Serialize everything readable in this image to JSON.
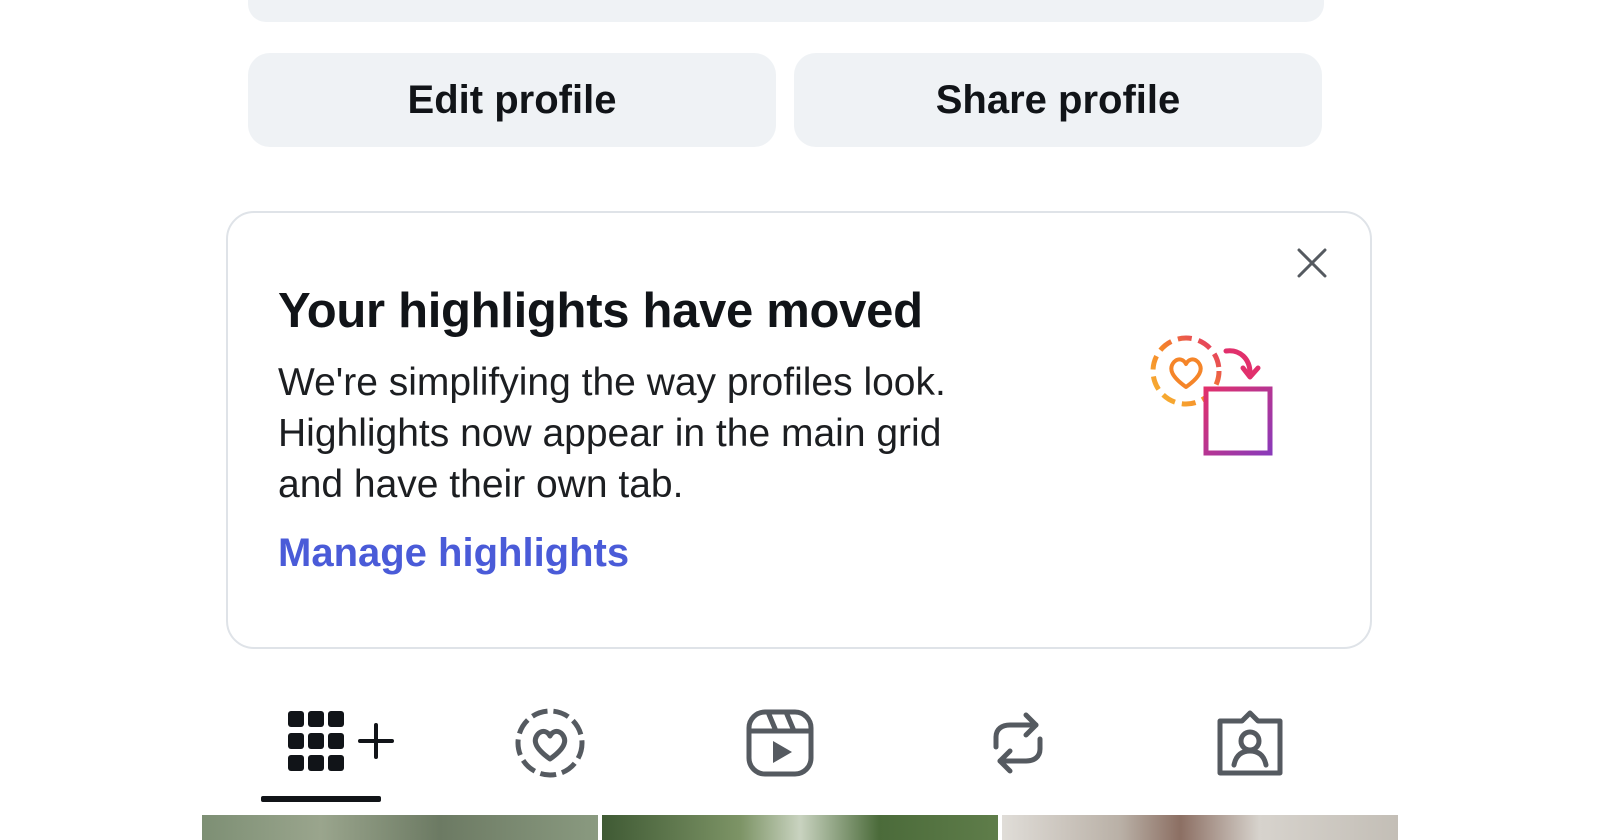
{
  "profile_actions": {
    "edit_label": "Edit profile",
    "share_label": "Share profile"
  },
  "notice_card": {
    "title": "Your highlights have moved",
    "body_lines": [
      "We're simplifying the way profiles look.",
      "Highlights now appear in the main grid",
      "and have their own tab."
    ],
    "link_label": "Manage highlights",
    "close_icon": "close-icon",
    "illustration_icon": "highlights-to-grid-icon",
    "link_color": "#4a5bd8"
  },
  "tabs": [
    {
      "name": "posts-grid",
      "icon": "grid-icon",
      "selected": true
    },
    {
      "name": "highlights",
      "icon": "heart-circle-icon",
      "selected": false
    },
    {
      "name": "reels",
      "icon": "reels-icon",
      "selected": false
    },
    {
      "name": "reposts",
      "icon": "repost-icon",
      "selected": false
    },
    {
      "name": "tagged",
      "icon": "tagged-icon",
      "selected": false
    }
  ],
  "colors": {
    "button_bg": "#eff2f5",
    "text_primary": "#111418",
    "card_border": "#dfe3e8"
  }
}
